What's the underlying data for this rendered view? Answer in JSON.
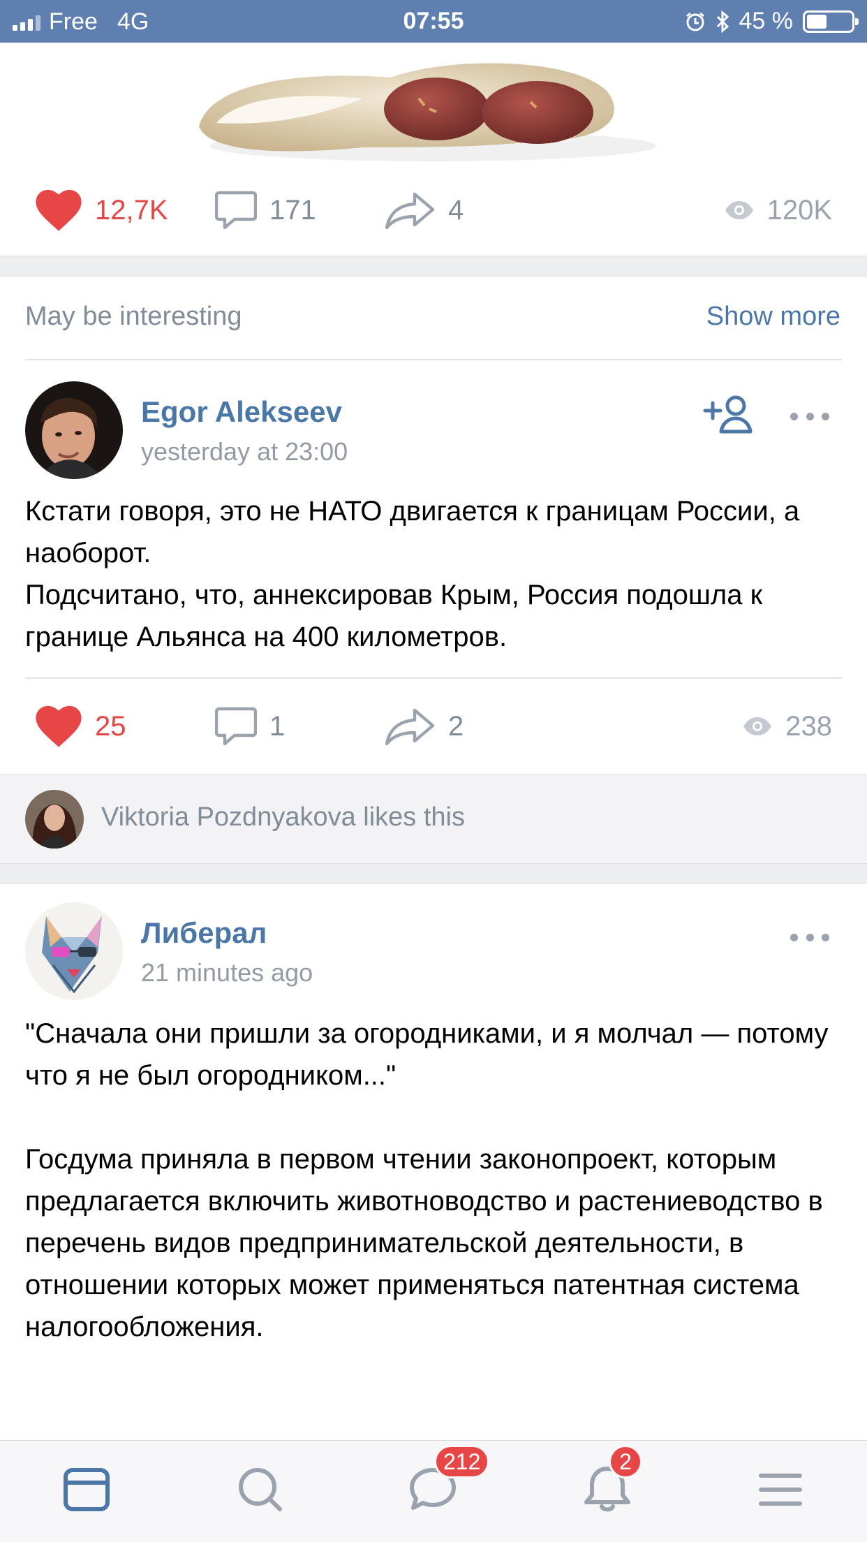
{
  "status_bar": {
    "carrier": "Free",
    "network": "4G",
    "time": "07:55",
    "battery_text": "45 %",
    "battery_level": 0.45
  },
  "post_top": {
    "likes": "12,7K",
    "comments": "171",
    "shares": "4",
    "views": "120K"
  },
  "recommendations": {
    "title": "May be interesting",
    "show_more": "Show more"
  },
  "post1": {
    "author": "Egor Alekseev",
    "time": "yesterday at 23:00",
    "text": "Кстати говоря, это не НАТО двигается к границам России, а наоборот.\nПодсчитано, что, аннексировав Крым, Россия подошла к границе Альянса на 400 километров.",
    "likes": "25",
    "comments": "1",
    "shares": "2",
    "views": "238",
    "liked_by_text": "Viktoria Pozdnyakova likes this"
  },
  "post2": {
    "author": "Либерал",
    "time": "21 minutes ago",
    "text": "\"Сначала они пришли за огородниками, и я молчал — потому что я не был огородником...\"\n\nГосдума приняла в первом чтении законопроект, которым предлагается включить животноводство и растениеводство в перечень видов предпринимательской деятельности, в отношении которых может применяться патентная система налогообложения."
  },
  "tabbar": {
    "messages_badge": "212",
    "notifications_badge": "2"
  },
  "colors": {
    "accent": "#4a76a8",
    "like_red": "#e64646",
    "status_bar": "#5f7fb0",
    "secondary_text": "#818c99"
  },
  "icons": [
    "heart-icon",
    "comment-icon",
    "share-icon",
    "eye-icon",
    "add-friend-icon",
    "more-icon",
    "news-tab-icon",
    "search-tab-icon",
    "messages-tab-icon",
    "notifications-tab-icon",
    "menu-tab-icon"
  ]
}
